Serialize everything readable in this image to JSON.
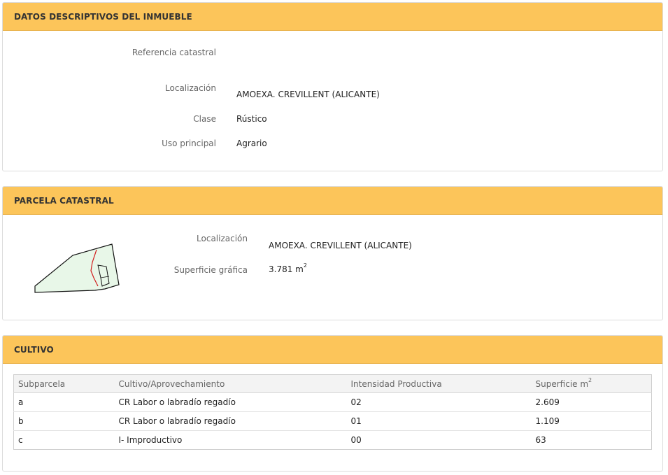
{
  "descriptive": {
    "title": "DATOS DESCRIPTIVOS DEL INMUEBLE",
    "fields": [
      {
        "label": "Referencia catastral",
        "value": ""
      },
      {
        "label": "Localización",
        "value": "AMOEXA. CREVILLENT (ALICANTE)"
      },
      {
        "label": "Clase",
        "value": "Rústico"
      },
      {
        "label": "Uso principal",
        "value": "Agrario"
      }
    ]
  },
  "parcel": {
    "title": "PARCELA CATASTRAL",
    "location_label": "Localización",
    "location_value": "AMOEXA. CREVILLENT (ALICANTE)",
    "surface_label": "Superficie gráfica",
    "surface_value": "3.781 m",
    "surface_unit_exp": "2",
    "map_fill": "#e8f7e8",
    "map_subdivision_color": "#d21c1c"
  },
  "cultivation": {
    "title": "CULTIVO",
    "columns": [
      "Subparcela",
      "Cultivo/Aprovechamiento",
      "Intensidad Productiva",
      "Superficie m"
    ],
    "surface_exp": "2",
    "rows": [
      [
        "a",
        "CR Labor o labradío regadío",
        "02",
        "2.609"
      ],
      [
        "b",
        "CR Labor o labradío regadío",
        "01",
        "1.109"
      ],
      [
        "c",
        "I- Improductivo",
        "00",
        "63"
      ]
    ]
  },
  "colors": {
    "header_bg": "#fcc55a",
    "panel_border": "#dcdcdc"
  }
}
